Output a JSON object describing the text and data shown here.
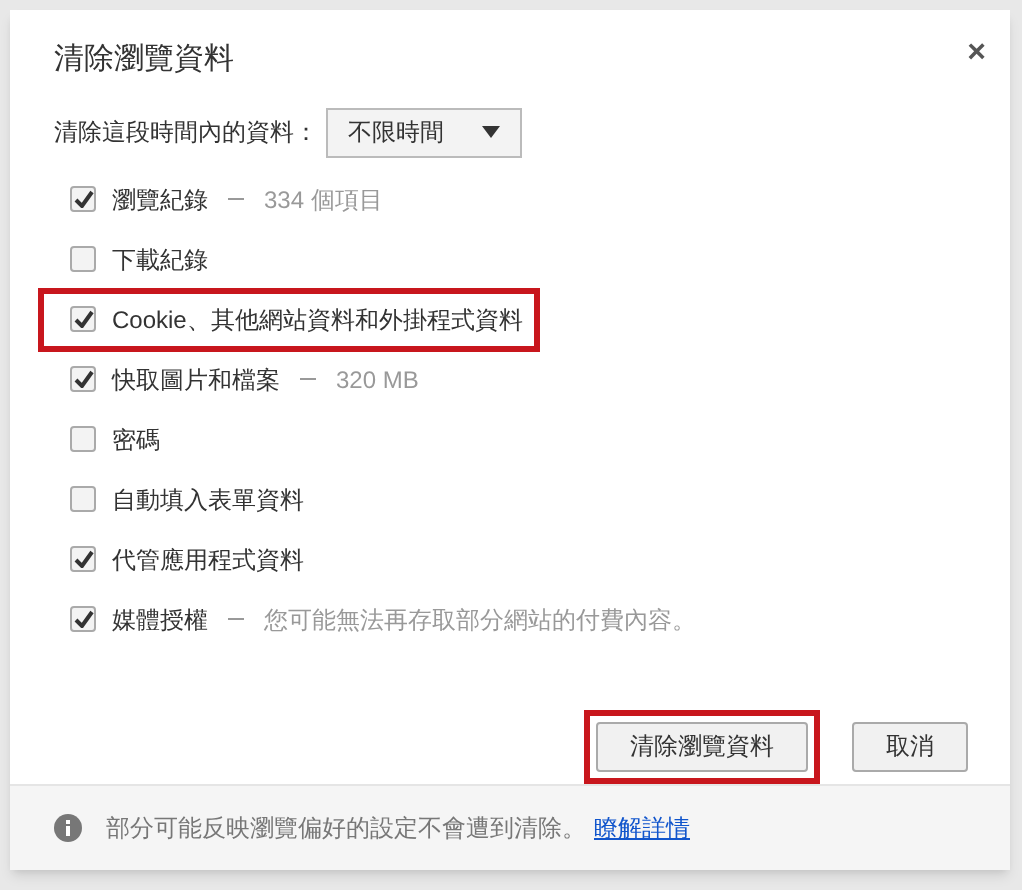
{
  "dialog": {
    "title": "清除瀏覽資料",
    "close": "×"
  },
  "time_range": {
    "label": "清除這段時間內的資料：",
    "value": "不限時間"
  },
  "items": [
    {
      "label": "瀏覽紀錄",
      "detail": "334 個項目",
      "checked": true,
      "highlighted": false
    },
    {
      "label": "下載紀錄",
      "checked": false,
      "highlighted": false
    },
    {
      "label": "Cookie、其他網站資料和外掛程式資料",
      "checked": true,
      "highlighted": true
    },
    {
      "label": "快取圖片和檔案",
      "detail": "320 MB",
      "checked": true,
      "highlighted": false
    },
    {
      "label": "密碼",
      "checked": false,
      "highlighted": false
    },
    {
      "label": "自動填入表單資料",
      "checked": false,
      "highlighted": false
    },
    {
      "label": "代管應用程式資料",
      "checked": true,
      "highlighted": false
    },
    {
      "label": "媒體授權",
      "detail": "您可能無法再存取部分網站的付費內容。",
      "checked": true,
      "highlighted": false
    }
  ],
  "buttons": [
    {
      "label": "清除瀏覽資料",
      "highlighted": true
    },
    {
      "label": "取消",
      "highlighted": false
    }
  ],
  "footer": {
    "text": "部分可能反映瀏覽偏好的設定不會遭到清除。",
    "link": "瞭解詳情"
  }
}
